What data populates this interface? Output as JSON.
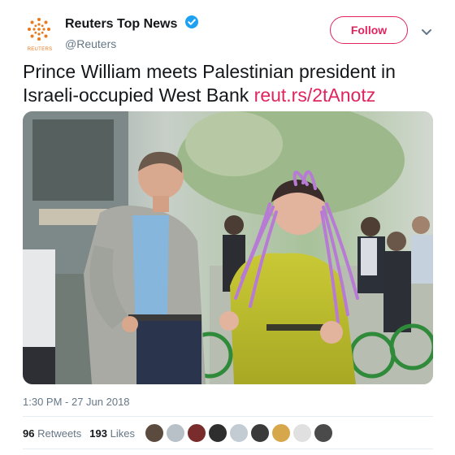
{
  "account": {
    "display_name": "Reuters Top News",
    "handle": "@Reuters",
    "avatar_label": "REUTERS",
    "verified_icon": "verified-badge-icon"
  },
  "actions": {
    "follow_label": "Follow",
    "more_icon": "chevron-down-icon"
  },
  "tweet": {
    "text": "Prince William meets Palestinian president in Israeli-occupied West Bank ",
    "link": "reut.rs/2tAnotz",
    "timestamp": "1:30 PM - 27 Jun 2018"
  },
  "stats": {
    "retweets_count": "96",
    "retweets_label": "Retweets",
    "likes_count": "193",
    "likes_label": "Likes"
  },
  "likers": [
    {
      "name": "liker-avatar-1",
      "color": "#5b4a3e"
    },
    {
      "name": "liker-avatar-2",
      "color": "#b8c0c8"
    },
    {
      "name": "liker-avatar-3",
      "color": "#7a2b2b"
    },
    {
      "name": "liker-avatar-4",
      "color": "#2e2e2e"
    },
    {
      "name": "liker-avatar-5",
      "color": "#c3cbd3"
    },
    {
      "name": "liker-avatar-6",
      "color": "#3a3a3a"
    },
    {
      "name": "liker-avatar-7",
      "color": "#d7a84b"
    },
    {
      "name": "liker-avatar-8",
      "color": "#e0e0e0"
    },
    {
      "name": "liker-avatar-9",
      "color": "#4a4a4a"
    }
  ],
  "colors": {
    "accent": "#e0245e",
    "verified": "#1da1f2",
    "secondary_text": "#657786",
    "brand_orange": "#e87a1c"
  }
}
